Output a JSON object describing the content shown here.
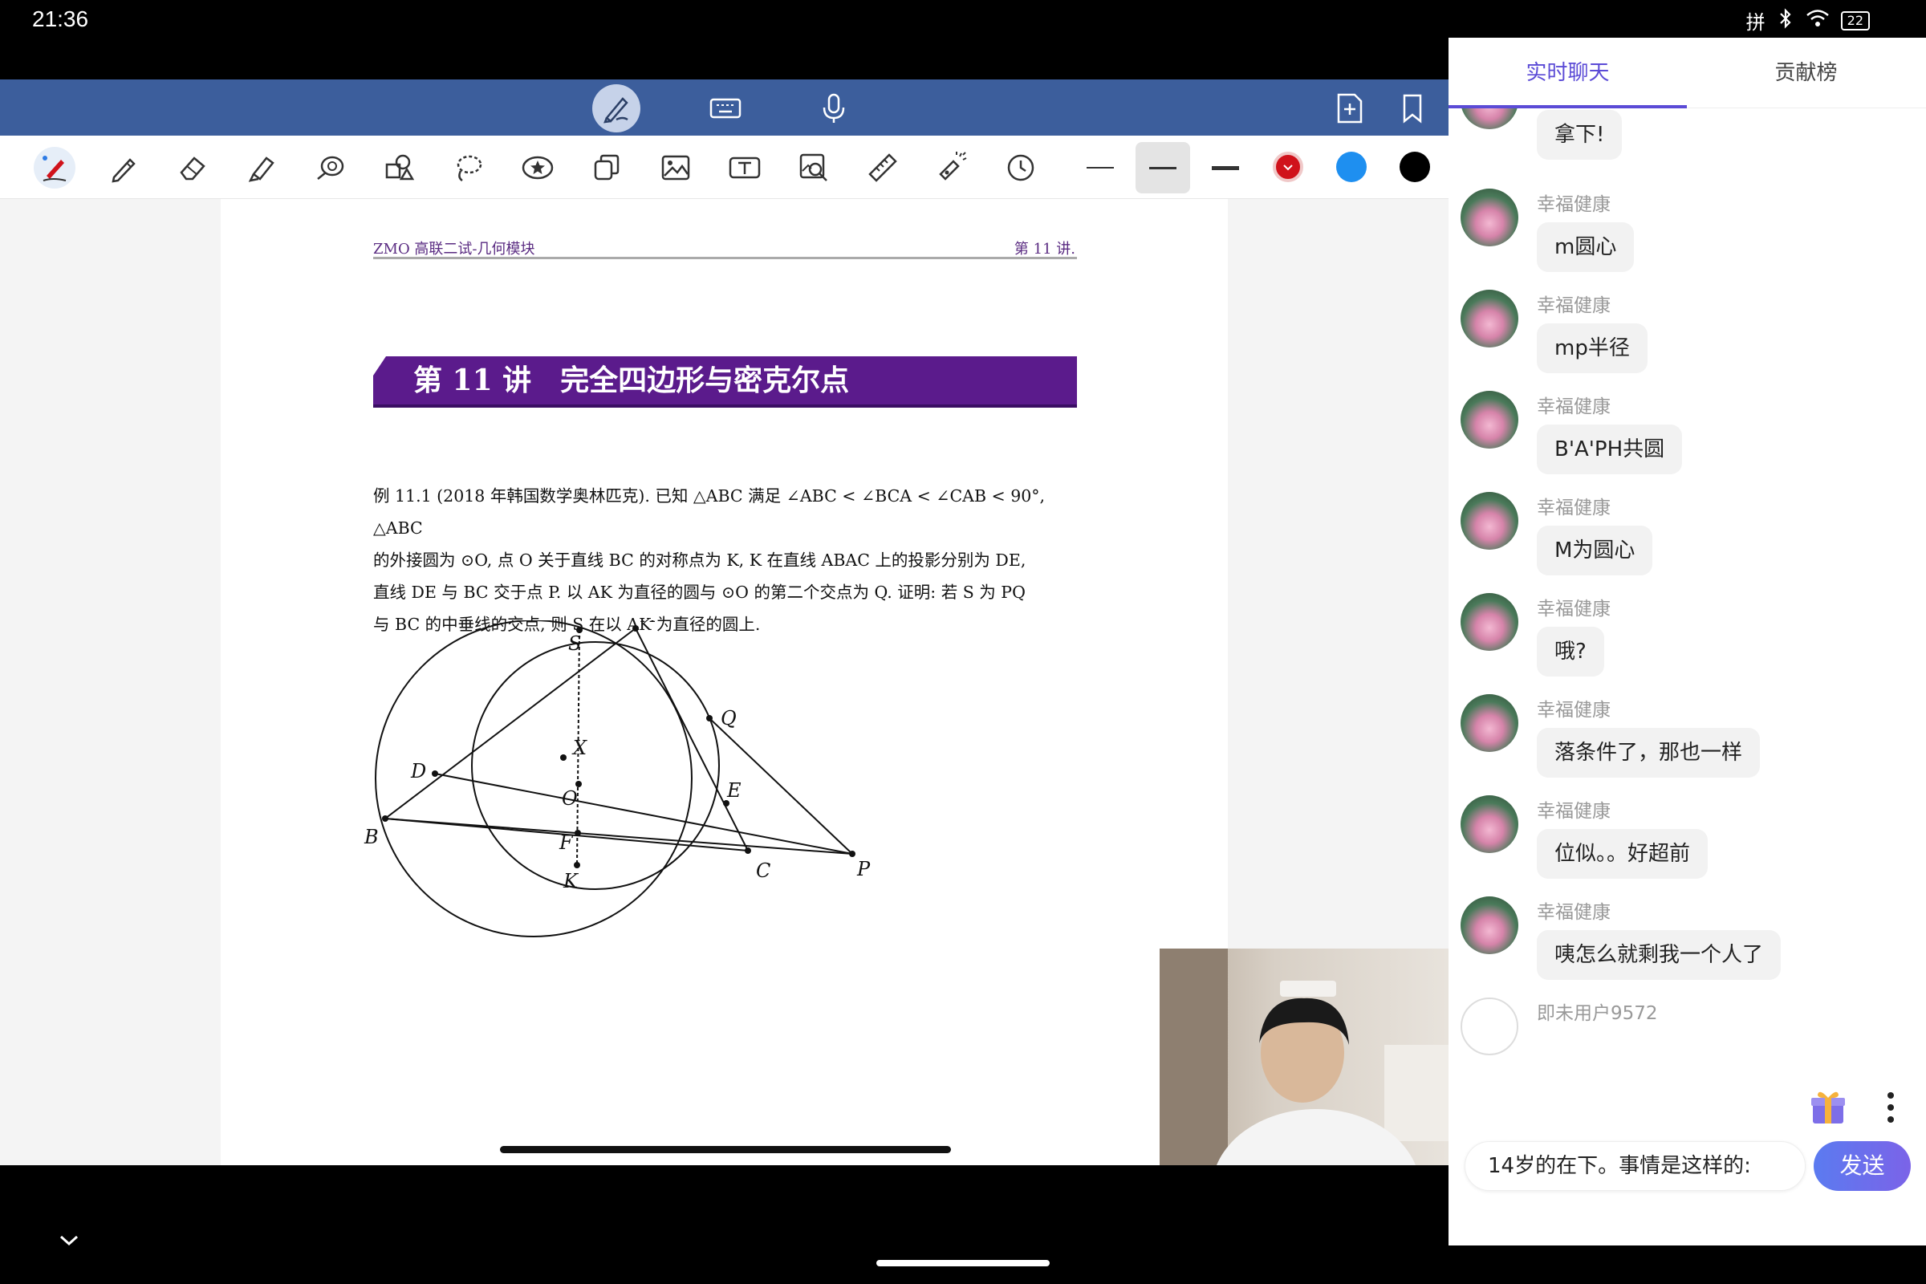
{
  "status": {
    "time": "21:36",
    "ime": "拼",
    "battery": "22"
  },
  "document": {
    "header_left": "ZMO 高联二试-几何模块",
    "header_right": "第 11 讲.",
    "banner": "第 11 讲　完全四边形与密克尔点",
    "problem_lines": [
      "例 11.1 (2018 年韩国数学奥林匹克). 已知 △ABC 满足 ∠ABC < ∠BCA < ∠CAB < 90°, △ABC",
      "的外接圆为 ⊙O, 点 O 关于直线 BC 的对称点为 K, K 在直线 ABAC 上的投影分别为 DE,",
      "直线 DE 与 BC 交于点 P. 以 AK 为直径的圆与 ⊙O 的第二个交点为 Q. 证明: 若 S 为 PQ",
      "与 BC 的中垂线的交点, 则 S 在以 AK 为直径的圆上."
    ],
    "figure_labels": [
      "A",
      "S",
      "Q",
      "X",
      "D",
      "O",
      "E",
      "B",
      "F",
      "C",
      "P",
      "K"
    ]
  },
  "toolbar": {
    "top_icons": [
      "pen-mode-icon",
      "keyboard-icon",
      "microphone-icon",
      "add-page-icon",
      "bookmark-icon"
    ],
    "tools": [
      "smart-pen-icon",
      "pencil-icon",
      "eraser-icon",
      "highlighter-icon",
      "shape-recognize-icon",
      "shapes-icon",
      "lasso-icon",
      "sticker-icon",
      "copy-icon",
      "image-icon",
      "text-box-icon",
      "image-search-icon",
      "ruler-icon",
      "laser-pointer-icon",
      "history-icon"
    ],
    "stroke_widths": [
      "thin",
      "medium",
      "thick"
    ],
    "colors": [
      "#d0121b",
      "#1e8ff0",
      "#000000"
    ]
  },
  "chat": {
    "tabs": [
      "实时聊天",
      "贡献榜"
    ],
    "messages": [
      {
        "user": "",
        "text": "拿下!"
      },
      {
        "user": "幸福健康",
        "text": "m圆心"
      },
      {
        "user": "幸福健康",
        "text": "mp半径"
      },
      {
        "user": "幸福健康",
        "text": "B'A'PH共圆"
      },
      {
        "user": "幸福健康",
        "text": "M为圆心"
      },
      {
        "user": "幸福健康",
        "text": "哦?"
      },
      {
        "user": "幸福健康",
        "text": "落条件了，那也一样"
      },
      {
        "user": "幸福健康",
        "text": "位似。。好超前"
      },
      {
        "user": "幸福健康",
        "text": "咦怎么就剩我一个人了"
      },
      {
        "user": "即未用户9572",
        "text": ""
      }
    ],
    "input_value": "14岁的在下。事情是这样的:",
    "send_label": "发送"
  }
}
